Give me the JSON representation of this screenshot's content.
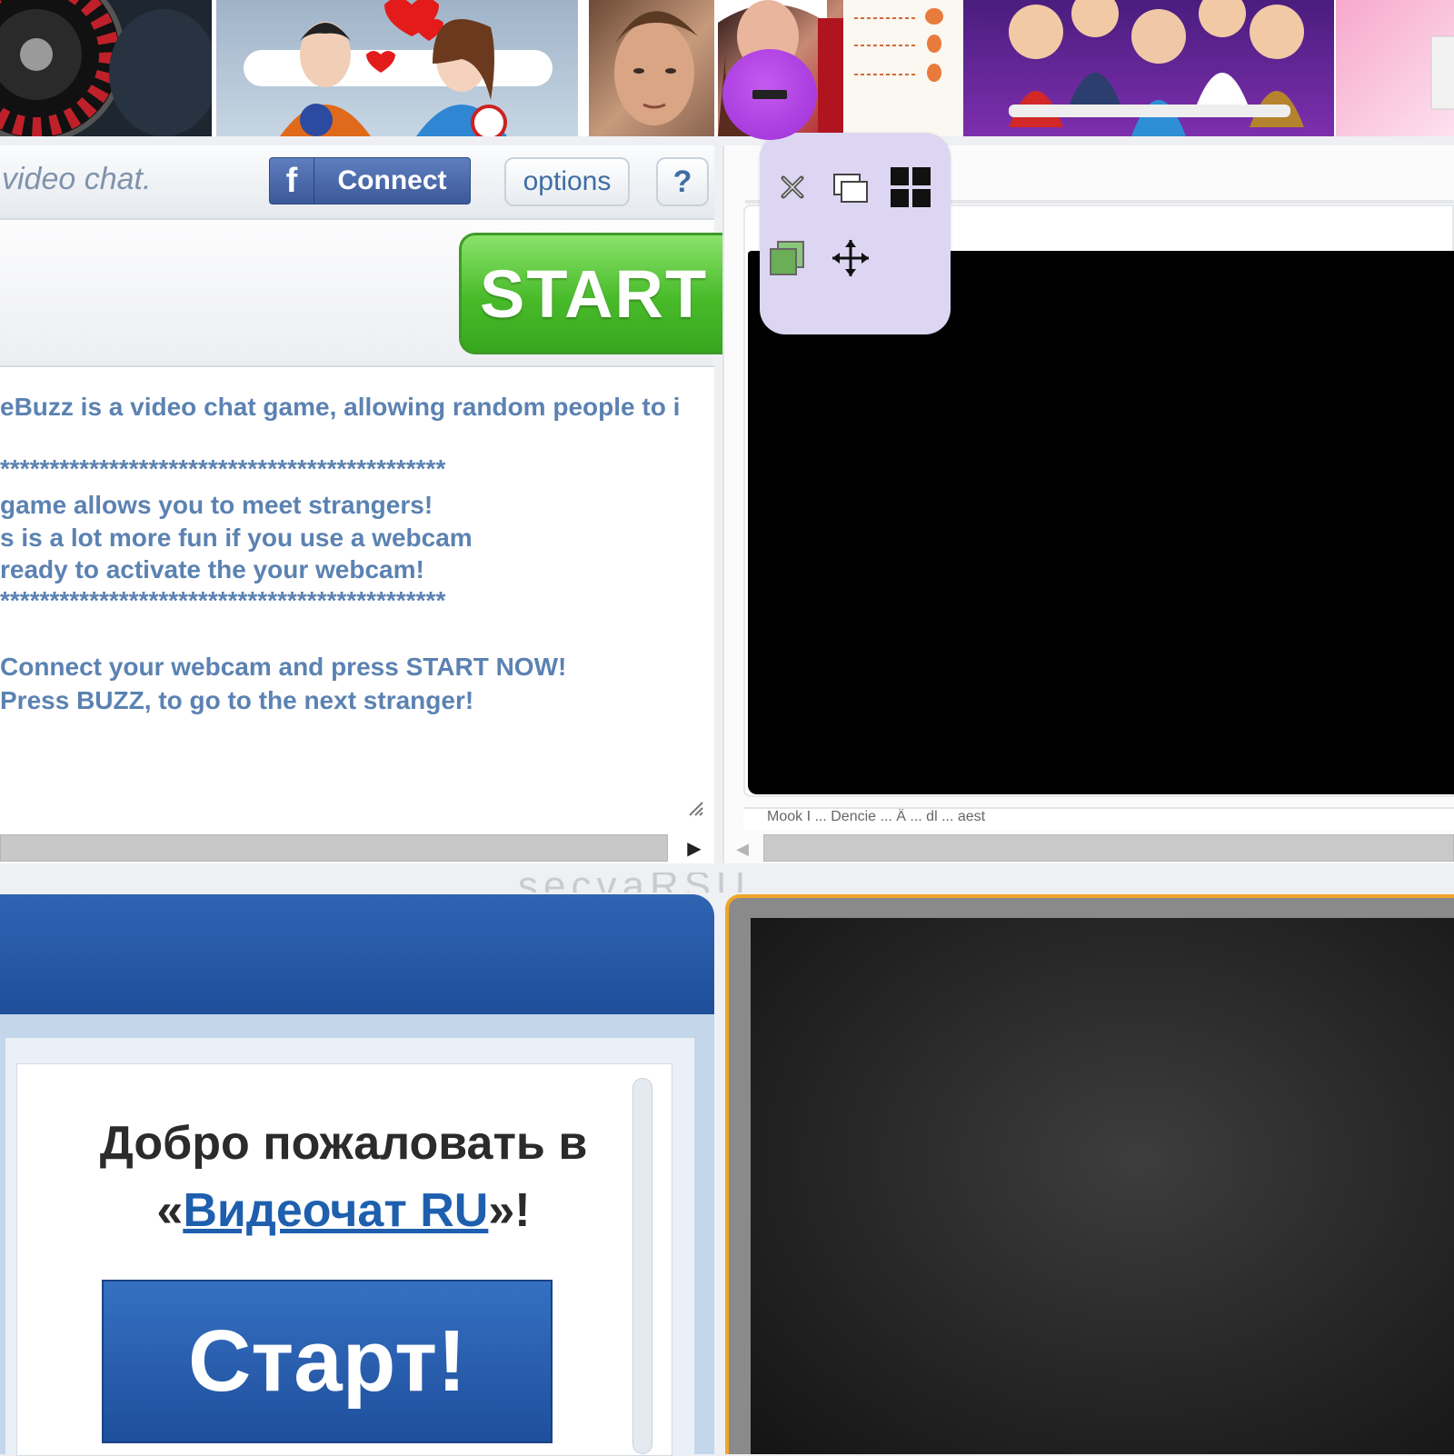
{
  "left_panel": {
    "tagline": "video chat.",
    "fb_letter": "f",
    "fb_connect_label": "Connect",
    "options_label": "options",
    "help_label": "?",
    "start_label": "START",
    "info_lines": [
      "eBuzz is a video chat game, allowing random people to i",
      "*********************************************",
      " game allows you to meet strangers!",
      "s is a lot more fun if you use a webcam",
      " ready to activate the your webcam!",
      "*********************************************",
      "Connect your webcam and press  START NOW!",
      "Press BUZZ, to go to the next stranger!"
    ],
    "scroll_arrow": "▶"
  },
  "right_panel": {
    "status_text": "Mook I ... Dencie ... Ä ... dl ... aest",
    "scroll_arrow": "◀"
  },
  "bottom": {
    "watermark": "secvaRSU",
    "welcome_line1": "Добро пожаловать в",
    "welcome_open_quote": "«",
    "welcome_link": "Видеочат RU",
    "welcome_close_quote": "»!",
    "start_ru_label": "Старт!"
  },
  "colors": {
    "start_green": "#48bb2a",
    "fb_blue": "#3b5998",
    "ru_blue": "#1e4f9c",
    "palette_lavender": "#ddd6f2",
    "minimize_purple": "#9b2fd6",
    "frame_orange": "#f0a52a"
  }
}
